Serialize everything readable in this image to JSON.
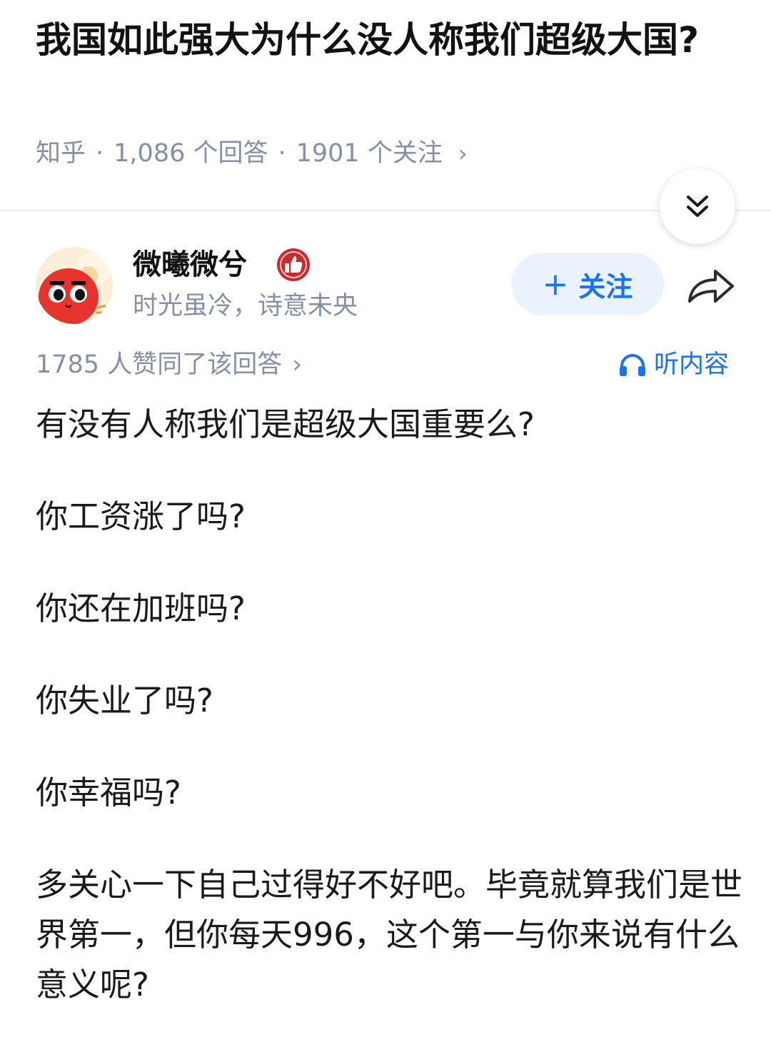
{
  "question": {
    "title": "我国如此强大为什么没人称我们超级大国?",
    "source": "知乎",
    "answers_count": "1,086 个回答",
    "follows_count": "1901 个关注",
    "meta_chevron": "›"
  },
  "author": {
    "name": "微曦微兮",
    "bio": "时光虽冷，诗意未央",
    "follow_plus": "+",
    "follow_label": "关注"
  },
  "answer": {
    "votes": "1785 人赞同了该回答",
    "votes_chevron": "›",
    "listen_label": "听内容",
    "paragraphs": [
      "有没有人称我们是超级大国重要么?",
      "你工资涨了吗?",
      "你还在加班吗?",
      "你失业了吗?",
      "你幸福吗?",
      "多关心一下自己过得好不好吧。毕竟就算我们是世界第一，但你每天996，这个第一与你来说有什么意义呢?"
    ]
  },
  "icons": {
    "collapse": "double-chevron-down-icon",
    "badge": "thumbs-up-badge-icon",
    "share": "share-arrow-icon",
    "listen": "headphones-icon"
  },
  "colors": {
    "accent": "#1772f6",
    "meta": "#8590a6",
    "follow_bg": "#eaf3fd"
  }
}
